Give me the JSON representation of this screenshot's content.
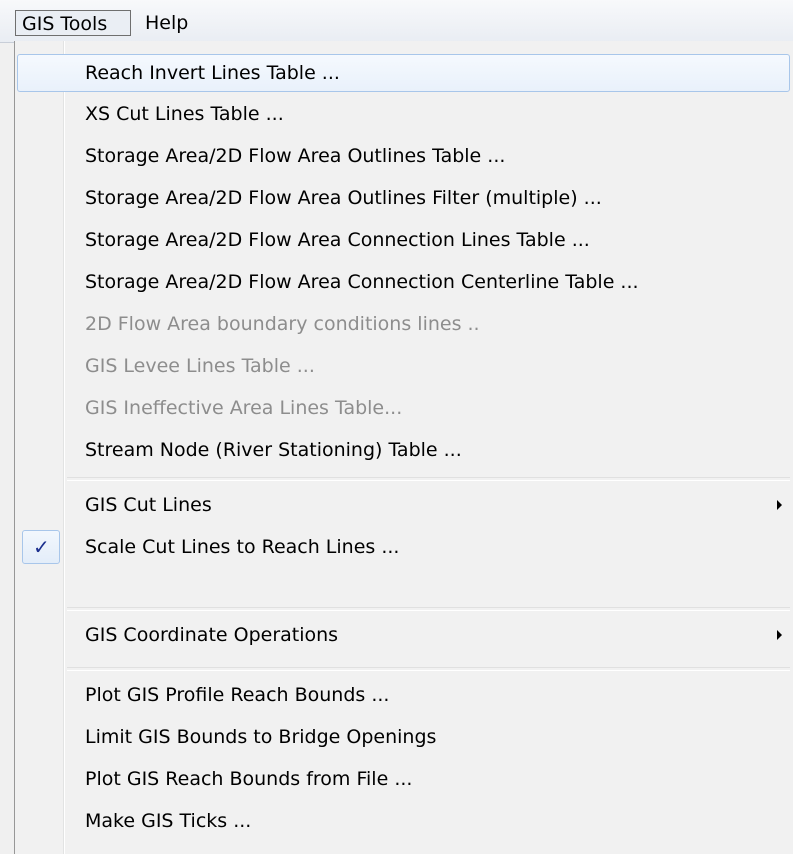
{
  "menubar": {
    "open_menu_label": "GIS Tools",
    "help_label": "Help"
  },
  "menu": {
    "items": [
      {
        "label": "Reach Invert Lines Table ..."
      },
      {
        "label": "XS Cut Lines Table ..."
      },
      {
        "label": "Storage Area/2D Flow Area Outlines Table ..."
      },
      {
        "label": "Storage Area/2D Flow Area Outlines Filter (multiple) ..."
      },
      {
        "label": "Storage Area/2D Flow Area Connection Lines Table ..."
      },
      {
        "label": "Storage Area/2D Flow Area Connection Centerline Table ..."
      },
      {
        "label": "2D Flow Area boundary conditions lines .."
      },
      {
        "label": "GIS Levee Lines Table ..."
      },
      {
        "label": "GIS Ineffective Area Lines Table..."
      },
      {
        "label": "Stream Node (River Stationing) Table ..."
      },
      {
        "label": "GIS Cut Lines"
      },
      {
        "label": "Scale Cut Lines to Reach Lines ...",
        "checked": true
      },
      {
        "label": "GIS Coordinate Operations"
      },
      {
        "label": "Plot GIS Profile Reach Bounds ..."
      },
      {
        "label": "Limit GIS Bounds to Bridge Openings"
      },
      {
        "label": "Plot GIS Reach Bounds from File ..."
      },
      {
        "label": "Make GIS Ticks ..."
      }
    ],
    "check_glyph": "✓",
    "colors": {
      "disabled_text": "#8d8d8d",
      "check": "#1b2f8e",
      "highlight_border": "#a8c6ea"
    }
  }
}
